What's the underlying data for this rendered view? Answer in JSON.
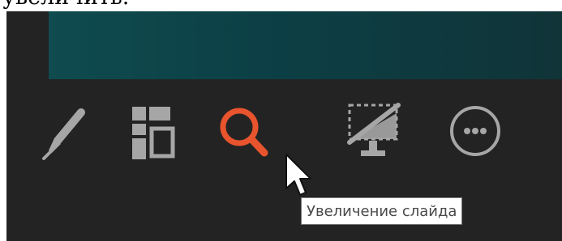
{
  "document": {
    "visible_text": "увеличить."
  },
  "toolbar": {
    "buttons": [
      {
        "name": "pen-tool",
        "icon": "pen-icon"
      },
      {
        "name": "see-all-slides",
        "icon": "slides-grid-icon"
      },
      {
        "name": "zoom-into-slide",
        "icon": "magnifier-icon",
        "highlighted": true
      },
      {
        "name": "black-screen",
        "icon": "screen-off-icon"
      },
      {
        "name": "more-options",
        "icon": "ellipsis-circle-icon"
      }
    ]
  },
  "tooltip": {
    "text": "Увеличение слайда"
  },
  "colors": {
    "background": "#232323",
    "icon": "#a6a6a6",
    "active_icon": "#e8542d",
    "slide": "#0f4b4f"
  }
}
